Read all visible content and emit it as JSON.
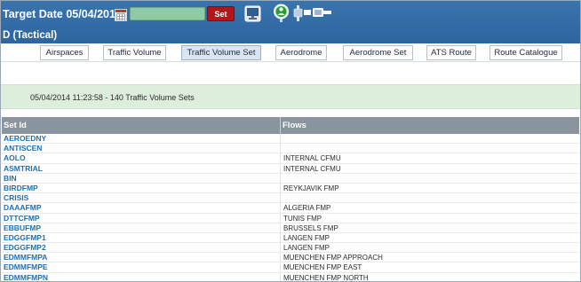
{
  "header": {
    "title": "Target Date 05/04/2014",
    "set_label": "Set",
    "mode_label": "D (Tactical)"
  },
  "tabs": [
    {
      "label": "Airspaces",
      "active": false
    },
    {
      "label": "Traffic Volume",
      "active": false
    },
    {
      "label": "Traffic Volume Set",
      "active": true
    },
    {
      "label": "Aerodrome",
      "active": false
    },
    {
      "label": "Aerodrome Set",
      "active": false
    },
    {
      "label": "ATS Route",
      "active": false
    },
    {
      "label": "Route Catalogue",
      "active": false
    }
  ],
  "status": {
    "message": "05/04/2014 11:23:58 - 140 Traffic Volume Sets"
  },
  "table": {
    "columns": [
      "Set Id",
      "Flows"
    ],
    "rows": [
      {
        "set_id": "AEROEDNY",
        "flows": ""
      },
      {
        "set_id": "ANTISCEN",
        "flows": ""
      },
      {
        "set_id": "AOLO",
        "flows": "INTERNAL CFMU"
      },
      {
        "set_id": "ASMTRIAL",
        "flows": "INTERNAL CFMU"
      },
      {
        "set_id": "BIN",
        "flows": ""
      },
      {
        "set_id": "BIRDFMP",
        "flows": "REYKJAVIK FMP"
      },
      {
        "set_id": "CRISIS",
        "flows": ""
      },
      {
        "set_id": "DAAAFMP",
        "flows": "ALGERIA FMP"
      },
      {
        "set_id": "DTTCFMP",
        "flows": "TUNIS FMP"
      },
      {
        "set_id": "EBBUFMP",
        "flows": "BRUSSELS FMP"
      },
      {
        "set_id": "EDGGFMP1",
        "flows": "LANGEN FMP"
      },
      {
        "set_id": "EDGGFMP2",
        "flows": "LANGEN FMP"
      },
      {
        "set_id": "EDMMFMPA",
        "flows": "MUENCHEN FMP APPROACH"
      },
      {
        "set_id": "EDMMFMPE",
        "flows": "MUENCHEN FMP EAST"
      },
      {
        "set_id": "EDMMFMPN",
        "flows": "MUENCHEN FMP NORTH"
      }
    ]
  },
  "colors": {
    "header_blue": "#2d659f",
    "set_button_red": "#b1161b",
    "status_green": "#ddeedd",
    "link_blue": "#1c70b6",
    "table_header_gray": "#8a949f"
  },
  "icons": [
    "calendar-icon",
    "monitor-icon",
    "globe-user-icon",
    "connection-icon"
  ]
}
